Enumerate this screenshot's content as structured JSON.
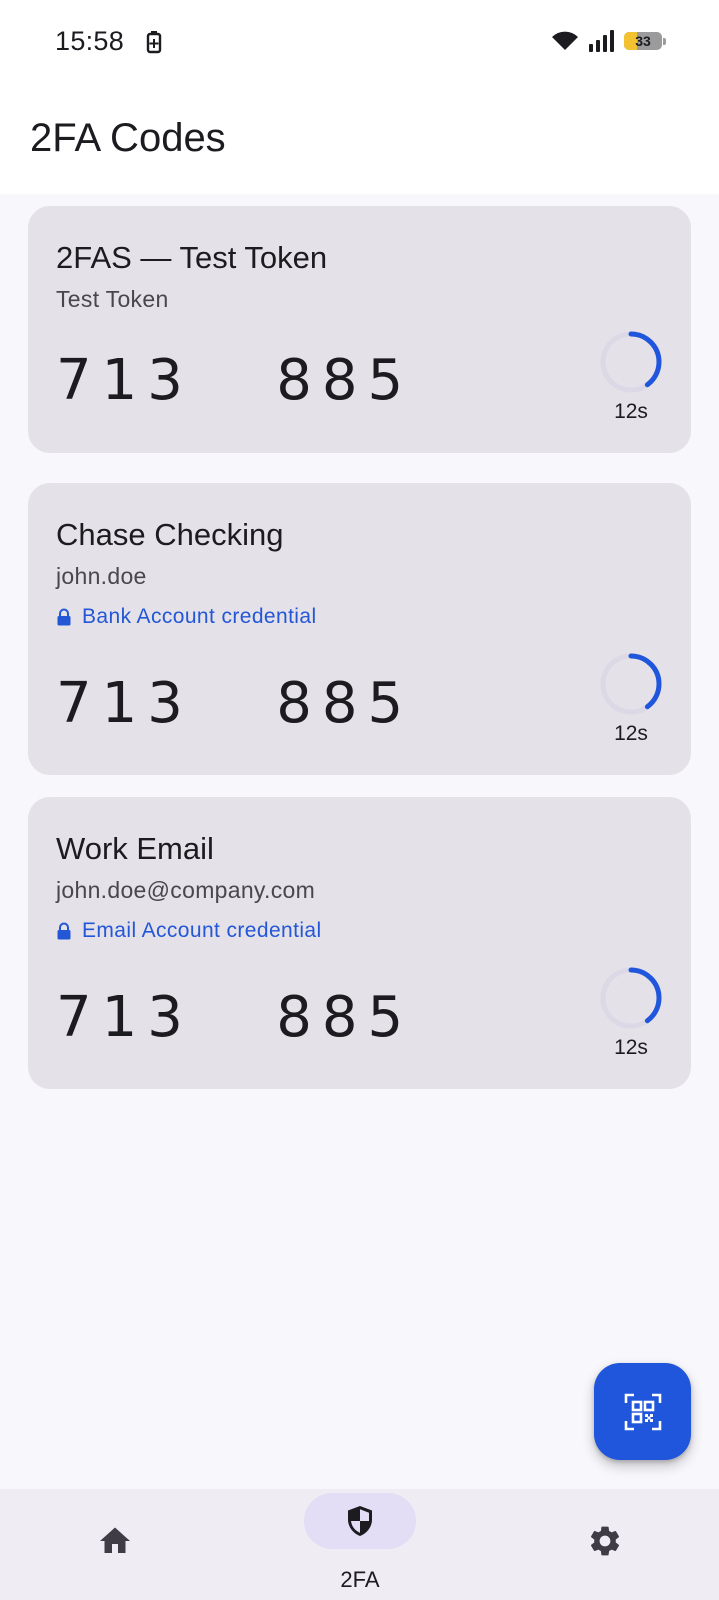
{
  "status_bar": {
    "time": "15:58",
    "battery_level": "33",
    "battery_fraction": 0.33,
    "icons": [
      "battery-saver-icon",
      "wifi-icon",
      "signal-icon",
      "battery-icon"
    ]
  },
  "header": {
    "title": "2FA Codes"
  },
  "cards": [
    {
      "title": "2FAS — Test Token",
      "subtitle": "Test Token",
      "credential": "",
      "code": "713 885",
      "timer_label": "12s",
      "timer_fraction": 0.4
    },
    {
      "title": "Chase Checking",
      "subtitle": "john.doe",
      "credential": "Bank Account credential",
      "code": "713 885",
      "timer_label": "12s",
      "timer_fraction": 0.4
    },
    {
      "title": "Work Email",
      "subtitle": "john.doe@company.com",
      "credential": "Email Account credential",
      "code": "713 885",
      "timer_label": "12s",
      "timer_fraction": 0.4
    }
  ],
  "fab": {
    "icon": "qr-scan-icon"
  },
  "bottom_nav": {
    "items": [
      {
        "icon": "home-icon",
        "label": ""
      },
      {
        "icon": "shield-icon",
        "label": "2FA",
        "active": true
      },
      {
        "icon": "gear-icon",
        "label": ""
      }
    ]
  },
  "colors": {
    "accent": "#1f56dc",
    "credential_text": "#2357d6",
    "card_bg": "#e4e1e8",
    "nav_active_pill": "#e3ddf5",
    "battery": "#f2c230"
  }
}
